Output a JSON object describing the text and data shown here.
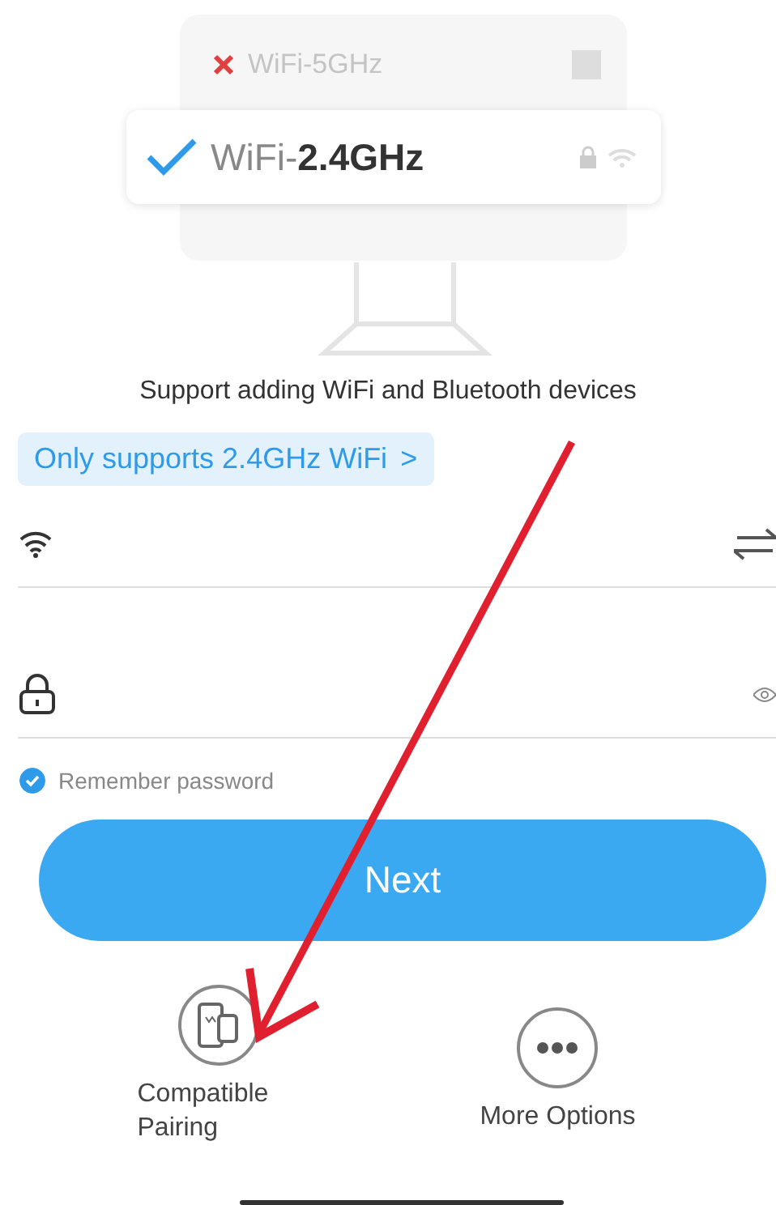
{
  "illustration": {
    "networks": [
      {
        "name": "WiFi-5GHz",
        "supported": false
      },
      {
        "name": "WiFi-**2.4GHz**",
        "supported": true
      }
    ]
  },
  "support_text": "Support adding WiFi and Bluetooth devices",
  "band_notice": {
    "label": "Only supports 2.4GHz WiFi",
    "chevron": ">"
  },
  "remember_password": {
    "label": "Remember password",
    "checked": true
  },
  "next_button": "Next",
  "options": [
    {
      "kind": "compatible",
      "label": "Compatible Pairing"
    },
    {
      "kind": "more",
      "label": "More Options"
    }
  ]
}
